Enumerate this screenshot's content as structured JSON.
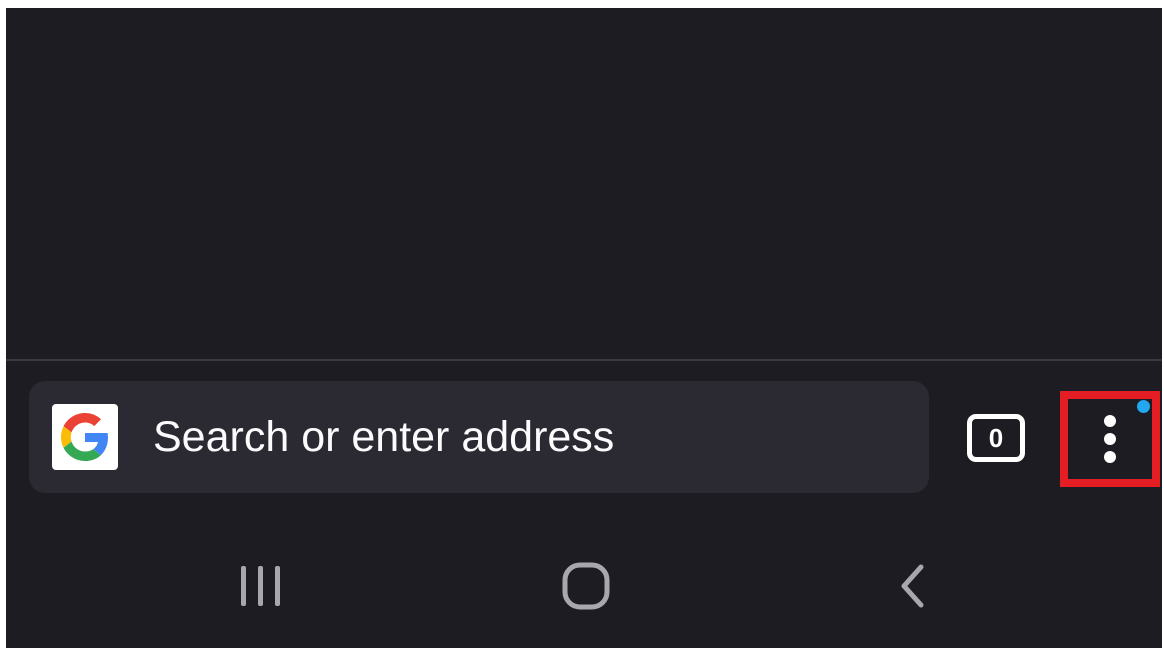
{
  "toolbar": {
    "search_placeholder": "Search or enter address",
    "search_engine_icon": "google-g-icon",
    "tabs_count": "0",
    "tabs_icon": "tab-counter-icon",
    "menu_icon": "three-dots-vertical-icon",
    "menu_has_notification": true,
    "menu_highlight_color": "#e51e25",
    "notification_color": "#22a7f0"
  },
  "system_nav": {
    "recents_icon": "recent-apps-icon",
    "home_icon": "home-icon",
    "back_icon": "back-chevron-icon"
  },
  "colors": {
    "background": "#1d1c22",
    "url_bar": "#2b2a33",
    "text": "#fbfbfe"
  }
}
